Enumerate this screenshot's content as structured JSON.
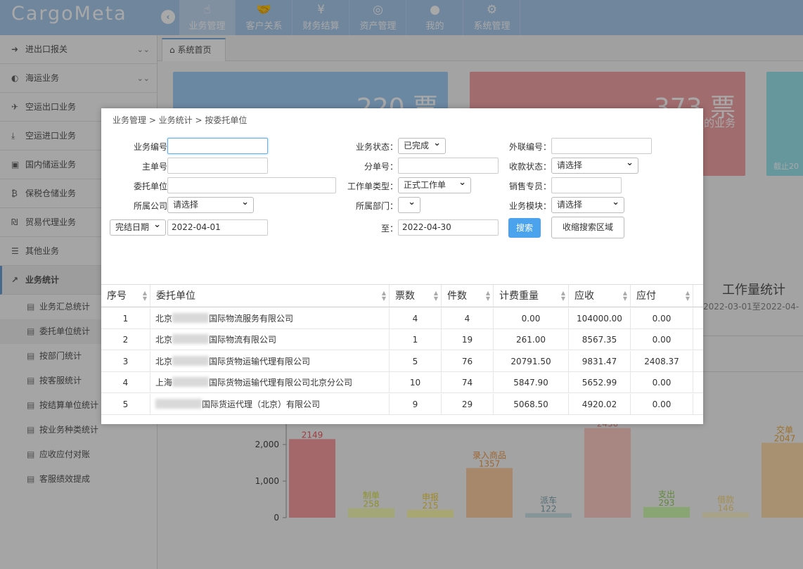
{
  "app": {
    "logo": "CargoMeta"
  },
  "topnav": [
    {
      "label": "业务管理",
      "icon": "hand-pointer-icon",
      "glyph": "☝"
    },
    {
      "label": "客户关系",
      "icon": "handshake-icon",
      "glyph": "🤝"
    },
    {
      "label": "财务结算",
      "icon": "yen-icon",
      "glyph": "¥"
    },
    {
      "label": "资产管理",
      "icon": "basketball-icon",
      "glyph": "◎"
    },
    {
      "label": "我的",
      "icon": "user-icon",
      "glyph": "●"
    },
    {
      "label": "系统管理",
      "icon": "gear-icon",
      "glyph": "⚙"
    }
  ],
  "sidebar": {
    "items": [
      {
        "label": "进出口报关",
        "icon": "sign-in-icon",
        "glyph": "➜"
      },
      {
        "label": "海运业务",
        "icon": "anchor-icon",
        "glyph": "◐"
      },
      {
        "label": "空运出口业务",
        "icon": "plane-icon",
        "glyph": "✈"
      },
      {
        "label": "空运进口业务",
        "icon": "download-icon",
        "glyph": "⤓"
      },
      {
        "label": "国内储运业务",
        "icon": "car-icon",
        "glyph": "▣"
      },
      {
        "label": "保税仓储业务",
        "icon": "bitcoin-icon",
        "glyph": "₿"
      },
      {
        "label": "贸易代理业务",
        "icon": "rupee-icon",
        "glyph": "₪"
      },
      {
        "label": "其他业务",
        "icon": "hamburger-icon",
        "glyph": "☰"
      },
      {
        "label": "业务统计",
        "icon": "line-chart-icon",
        "glyph": "↗"
      }
    ],
    "subitems": [
      "业务汇总统计",
      "委托单位统计",
      "按部门统计",
      "按客服统计",
      "按结算单位统计",
      "按业务种类统计",
      "应收应付对账",
      "客服绩效提成"
    ]
  },
  "tabs": {
    "home": "系统首页"
  },
  "dashboard": {
    "card1": {
      "value": "220 票"
    },
    "card2": {
      "value": "373 票",
      "label": "的业务"
    },
    "card3": {
      "label": "截止20"
    },
    "workload_title": "工作量统计",
    "workload_range": "2022-03-01至2022-04-"
  },
  "chart_data": {
    "type": "bar",
    "categories": [
      "",
      "制单",
      "申报",
      "录入商品",
      "派车",
      "",
      "支出",
      "借款",
      "交单"
    ],
    "values": [
      2149,
      258,
      215,
      1357,
      122,
      2450,
      293,
      146,
      2047
    ],
    "colors": [
      "#f99ea3",
      "#f8fcb5",
      "#fffeb0",
      "#ffcfa3",
      "#cbe3e7",
      "#ffcdc7",
      "#d1fab1",
      "#fff7cf",
      "#ffdcab"
    ],
    "label_colors": [
      "#f25c63",
      "#d8e03b",
      "#f2d33b",
      "#ef9b4d",
      "#7fa5b0",
      "#f0877c",
      "#92d057",
      "#f7d77a",
      "#f0a93b"
    ],
    "yticks": [
      "0",
      "1,000",
      "2,000"
    ],
    "ylim": [
      0,
      2500
    ]
  },
  "dialog": {
    "breadcrumb": "业务管理 > 业务统计 > 按委托单位",
    "form": {
      "biz_no_label": "业务编号：",
      "biz_no_value": "",
      "main_no_label": "主单号：",
      "main_no_value": "",
      "client_label": "委托单位：",
      "client_value": "",
      "company_label": "所属公司：",
      "company_value": "请选择",
      "date_type_value": "完结日期",
      "date_from": "2022-04-01",
      "status_label": "业务状态：",
      "status_value": "已完成",
      "sub_no_label": "分单号：",
      "sub_no_value": "",
      "order_type_label": "工作单类型：",
      "order_type_value": "正式工作单",
      "dept_label": "所属部门：",
      "dept_value": "",
      "to_label": "至：",
      "date_to": "2022-04-30",
      "ext_no_label": "外联编号：",
      "ext_no_value": "",
      "collect_label": "收款状态：",
      "collect_value": "请选择",
      "sales_label": "销售专员：",
      "sales_value": "",
      "module_label": "业务模块：",
      "module_value": "请选择",
      "search_btn": "搜索",
      "collapse_btn": "收缩搜索区域"
    },
    "table": {
      "headers": [
        "序号",
        "委托单位",
        "票数",
        "件数",
        "计费重量",
        "应收",
        "应付"
      ],
      "rows": [
        {
          "no": "1",
          "pre": "北京",
          "post": "国际物流服务有限公司",
          "tickets": "4",
          "pieces": "4",
          "weight": "0.00",
          "recv": "104000.00",
          "pay": "0.00"
        },
        {
          "no": "2",
          "pre": "北京",
          "post": "国际物流有限公司",
          "tickets": "1",
          "pieces": "19",
          "weight": "261.00",
          "recv": "8567.35",
          "pay": "0.00"
        },
        {
          "no": "3",
          "pre": "北京",
          "post": "国际货物运输代理有限公司",
          "tickets": "5",
          "pieces": "76",
          "weight": "20791.50",
          "recv": "9831.47",
          "pay": "2408.37"
        },
        {
          "no": "4",
          "pre": "上海",
          "post": "国际货物运输代理有限公司北京分公司",
          "tickets": "10",
          "pieces": "74",
          "weight": "5847.90",
          "recv": "5652.99",
          "pay": "0.00"
        },
        {
          "no": "5",
          "pre": "",
          "post": "国际货运代理（北京）有限公司",
          "tickets": "9",
          "pieces": "29",
          "weight": "5068.50",
          "recv": "4920.02",
          "pay": "0.00"
        }
      ]
    }
  }
}
